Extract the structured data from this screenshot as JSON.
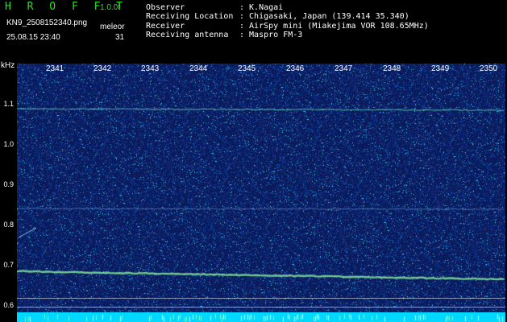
{
  "header": {
    "app_title": "H R O F F T",
    "version": "1.0.0f",
    "filename": "KN9_2508152340.png",
    "meleor_label": "meleor",
    "datetime": "25.08.15 23:40",
    "count": "31",
    "fields": [
      {
        "label": "Observer",
        "value": ": K.Nagai"
      },
      {
        "label": "Receiving Location",
        "value": ": Chigasaki, Japan (139.414 35.340)"
      },
      {
        "label": "Receiver",
        "value": ": AirSpy mini (Miakejima VOR 108.65MHz)"
      },
      {
        "label": "Receiving antenna",
        "value": ": Maspro FM-3"
      }
    ]
  },
  "axes": {
    "y_unit": "kHz",
    "y_ticks": [
      "1.1",
      "1.0",
      "0.9",
      "0.8",
      "0.7",
      "0.6"
    ],
    "x_ticks": [
      "2341",
      "2342",
      "2343",
      "2344",
      "2345",
      "2346",
      "2347",
      "2348",
      "2349",
      "2350"
    ]
  },
  "colors": {
    "background": "#000000",
    "title_green": "#27e027",
    "noise_base": "#0a1a5a",
    "signal": "#7fffd4",
    "strip": "#00d8ff"
  }
}
